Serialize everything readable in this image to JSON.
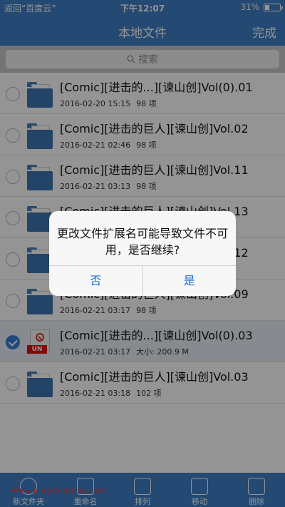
{
  "status_bar": {
    "back_label": "返回“百度云”",
    "time": "下午12:07",
    "battery": "31%",
    "battery_level": 0.31
  },
  "nav": {
    "title": "本地文件",
    "done_label": "完成"
  },
  "search": {
    "placeholder": "搜索",
    "icon": "search-icon"
  },
  "files": [
    {
      "name": "[Comic][进击的...][谏山创]Vol(0).01",
      "date": "2016-02-20 15:15",
      "detail": "98 项",
      "icon": "folder-icon",
      "checked": false
    },
    {
      "name": "[Comic][进击的巨人][谏山创]Vol.02",
      "date": "2016-02-21 02:46",
      "detail": "98 项",
      "icon": "folder-icon",
      "checked": false
    },
    {
      "name": "[Comic][进击的巨人][谏山创]Vol.11",
      "date": "2016-02-21 03:13",
      "detail": "98 项",
      "icon": "folder-icon",
      "checked": false
    },
    {
      "name": "[Comic][进击的巨人][谏山创]Vol.13",
      "date": "",
      "detail": "",
      "icon": "folder-icon",
      "checked": false
    },
    {
      "name": "[Comic][进击的巨人][谏山创]Vol.12",
      "date": "",
      "detail": "",
      "icon": "folder-icon",
      "checked": false
    },
    {
      "name": "[Comic][进击的巨人][谏山创]Vol.09",
      "date": "2016-02-21 03:17",
      "detail": "98 项",
      "icon": "folder-icon",
      "checked": false
    },
    {
      "name": "[Comic][进击的...][谏山创]Vol(0).03",
      "date": "2016-02-21 03:17",
      "detail": "大小: 200.9 M",
      "icon": "unknown-file-icon",
      "badge": "UN",
      "checked": true
    },
    {
      "name": "[Comic][进击的巨人][谏山创]Vol.03",
      "date": "2016-02-21 03:18",
      "detail": "102 项",
      "icon": "folder-icon",
      "checked": false
    }
  ],
  "toolbar": [
    {
      "label": "新文件夹",
      "icon": "new-folder-icon"
    },
    {
      "label": "重命名",
      "icon": "rename-icon"
    },
    {
      "label": "排列",
      "icon": "arrange-icon"
    },
    {
      "label": "移动",
      "icon": "move-icon"
    },
    {
      "label": "删除",
      "icon": "trash-icon"
    }
  ],
  "watermark": "www.pingitoutang.com",
  "dialog": {
    "message": "更改文件扩展名可能导致文件不可用，是否继续?",
    "cancel_label": "否",
    "confirm_label": "是"
  },
  "colors": {
    "nav_blue": "#3f7ec4",
    "check_blue": "#3b7fd6",
    "dialog_button": "#1e6fd9",
    "badge_red": "#d11111"
  }
}
